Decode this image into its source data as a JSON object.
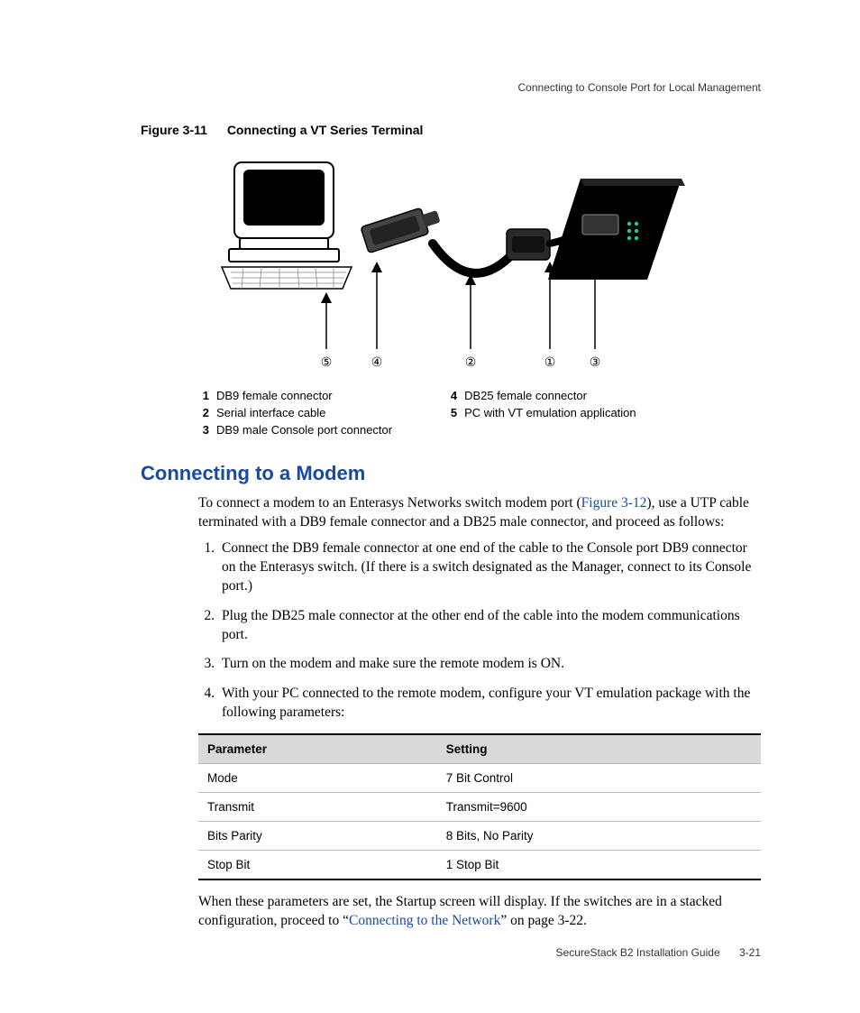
{
  "header": {
    "running": "Connecting to Console Port for Local Management"
  },
  "figure": {
    "number": "Figure 3-11",
    "title": "Connecting a VT Series Terminal",
    "callouts": [
      "⑤",
      "④",
      "②",
      "①",
      "③"
    ],
    "legend_left": [
      {
        "n": "1",
        "t": "DB9 female connector"
      },
      {
        "n": "2",
        "t": "Serial interface cable"
      },
      {
        "n": "3",
        "t": "DB9 male Console port connector"
      }
    ],
    "legend_right": [
      {
        "n": "4",
        "t": "DB25 female connector"
      },
      {
        "n": "5",
        "t": "PC with VT emulation application"
      }
    ]
  },
  "section": {
    "title": "Connecting to a Modem"
  },
  "intro": {
    "pre": "To connect a modem to an Enterasys Networks switch modem port (",
    "link": "Figure 3-12",
    "post": "), use a UTP cable terminated with a DB9 female connector and a DB25 male connector, and proceed as follows:"
  },
  "steps": [
    "Connect the DB9 female connector at one end of the cable to the Console port DB9 connector on the Enterasys switch. (If there is a switch designated as the Manager, connect to its Console port.)",
    "Plug the DB25 male connector at the other end of the cable into the modem communications port.",
    "Turn on the modem and make sure the remote modem is ON.",
    "With your PC connected to the remote modem, configure your VT emulation package with the following parameters:"
  ],
  "table": {
    "headers": [
      "Parameter",
      "Setting"
    ],
    "rows": [
      [
        "Mode",
        "7 Bit Control"
      ],
      [
        "Transmit",
        "Transmit=9600"
      ],
      [
        "Bits Parity",
        "8 Bits, No Parity"
      ],
      [
        "Stop Bit",
        "1 Stop Bit"
      ]
    ]
  },
  "closing": {
    "pre": "When these parameters are set, the Startup screen will display. If the switches are in a stacked configuration, proceed to “",
    "link": "Connecting to the Network",
    "post": "” on page 3-22."
  },
  "footer": {
    "guide": "SecureStack B2 Installation Guide",
    "page": "3-21"
  }
}
